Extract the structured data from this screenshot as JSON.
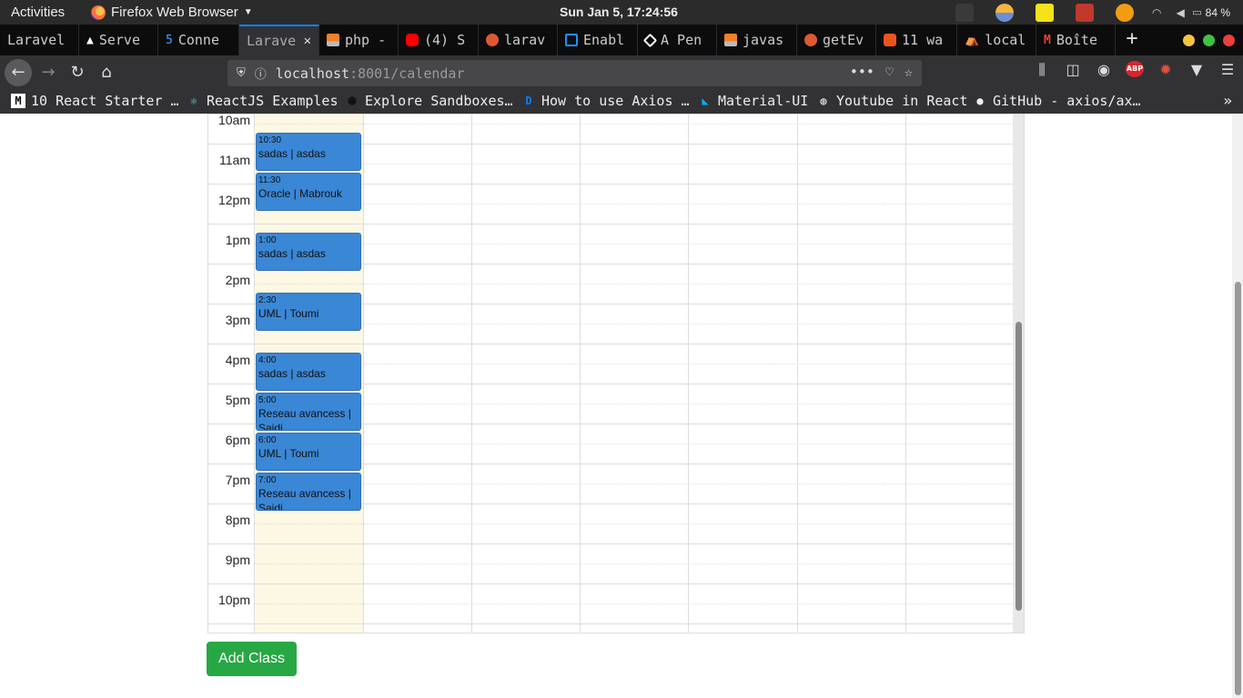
{
  "system_bar": {
    "activities": "Activities",
    "app_name": "Firefox Web Browser",
    "clock": "Sun Jan  5, 17:24:56",
    "battery": "84 %"
  },
  "tabs": [
    {
      "label": "Laravel",
      "icon": "laravel-icon",
      "active": false
    },
    {
      "label": "Serve",
      "icon": "warning-icon",
      "active": false
    },
    {
      "label": "Conne",
      "icon": "number-5-icon",
      "active": false
    },
    {
      "label": "Larave",
      "icon": "none",
      "active": true
    },
    {
      "label": "php -",
      "icon": "stackoverflow-icon",
      "active": false
    },
    {
      "label": "(4) S",
      "icon": "youtube-icon",
      "active": false
    },
    {
      "label": "larav",
      "icon": "duckduckgo-icon",
      "active": false
    },
    {
      "label": "Enabl",
      "icon": "window-icon",
      "active": false
    },
    {
      "label": "A Pen",
      "icon": "codepen-icon",
      "active": false
    },
    {
      "label": "javas",
      "icon": "stackoverflow-icon",
      "active": false
    },
    {
      "label": "getEv",
      "icon": "duckduckgo-icon",
      "active": false
    },
    {
      "label": "11 wa",
      "icon": "ubuntu-icon",
      "active": false
    },
    {
      "label": "local",
      "icon": "laravel-icon",
      "active": false
    },
    {
      "label": "Boîte",
      "icon": "gmail-icon",
      "active": false
    }
  ],
  "nav": {
    "url_host": "localhost",
    "url_path": ":8001/calendar"
  },
  "bookmarks": [
    {
      "label": "10 React Starter …",
      "icon": "medium-icon"
    },
    {
      "label": "ReactJS Examples",
      "icon": "react-icon"
    },
    {
      "label": "Explore Sandboxes…",
      "icon": "codesandbox-icon"
    },
    {
      "label": "How to use Axios …",
      "icon": "digitalocean-icon"
    },
    {
      "label": "Material-UI",
      "icon": "material-ui-icon"
    },
    {
      "label": "Youtube in React",
      "icon": "globe-icon"
    },
    {
      "label": "GitHub - axios/ax…",
      "icon": "github-icon"
    }
  ],
  "calendar": {
    "time_labels": [
      "10am",
      "11am",
      "12pm",
      "1pm",
      "2pm",
      "3pm",
      "4pm",
      "5pm",
      "6pm",
      "7pm",
      "8pm",
      "9pm",
      "10pm"
    ],
    "events": [
      {
        "time": "10:30",
        "title": "sadas | asdas"
      },
      {
        "time": "11:30",
        "title": "Oracle | Mabrouk"
      },
      {
        "time": "1:00",
        "title": "sadas | asdas"
      },
      {
        "time": "2:30",
        "title": "UML | Toumi"
      },
      {
        "time": "4:00",
        "title": "sadas | asdas"
      },
      {
        "time": "5:00",
        "title": "Reseau avancess | Saidi"
      },
      {
        "time": "6:00",
        "title": "UML | Toumi"
      },
      {
        "time": "7:00",
        "title": "Reseau avancess | Saidi"
      }
    ]
  },
  "add_class_button": "Add Class"
}
